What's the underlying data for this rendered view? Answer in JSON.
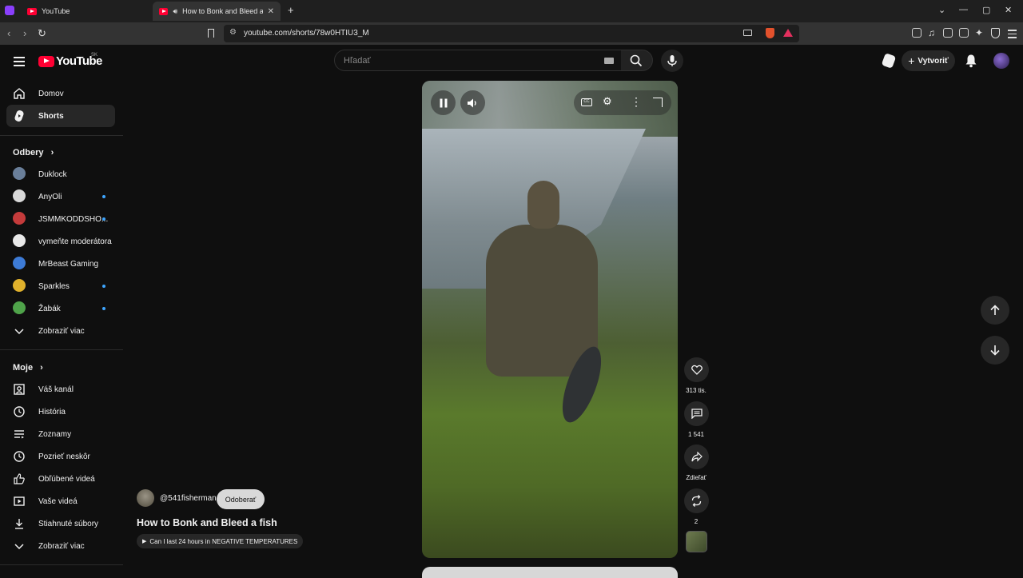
{
  "browser": {
    "tabs": [
      {
        "title": "YouTube",
        "active": false
      },
      {
        "title": "How to Bonk and Bleed a fish",
        "active": true
      }
    ],
    "url": "youtube.com/shorts/78w0HTIU3_M"
  },
  "masthead": {
    "logo_text": "YouTube",
    "country_code": "SK",
    "search_placeholder": "Hľadať",
    "create_label": "Vytvoriť"
  },
  "sidebar": {
    "main": [
      {
        "label": "Domov",
        "icon": "home-icon"
      },
      {
        "label": "Shorts",
        "icon": "shorts-icon",
        "active": true
      }
    ],
    "subscriptions_header": "Odbery",
    "subscriptions": [
      {
        "label": "Duklock",
        "live": false,
        "color": "#6a7f9a"
      },
      {
        "label": "AnyOli",
        "live": true,
        "color": "#d9d9d9"
      },
      {
        "label": "JSMMKODDSHO...",
        "live": true,
        "color": "#c43b3b"
      },
      {
        "label": "vymeňte moderátora",
        "live": false,
        "color": "#e8e8e8"
      },
      {
        "label": "MrBeast Gaming",
        "live": false,
        "color": "#3d7bd6"
      },
      {
        "label": "Sparkles",
        "live": true,
        "color": "#e0b12c"
      },
      {
        "label": "Žabák",
        "live": true,
        "color": "#4fa34a"
      }
    ],
    "subscriptions_more": "Zobraziť viac",
    "you_header": "Moje",
    "you_items": [
      {
        "label": "Váš kanál",
        "icon": "user-channel-icon"
      },
      {
        "label": "História",
        "icon": "history-icon"
      },
      {
        "label": "Zoznamy",
        "icon": "playlists-icon"
      },
      {
        "label": "Pozrieť neskôr",
        "icon": "watch-later-icon"
      },
      {
        "label": "Obľúbené videá",
        "icon": "thumbs-up-icon"
      },
      {
        "label": "Vaše videá",
        "icon": "your-videos-icon"
      },
      {
        "label": "Stiahnuté súbory",
        "icon": "download-icon"
      }
    ],
    "you_more": "Zobraziť viac"
  },
  "short": {
    "channel_handle": "@541fisherman",
    "subscribe_label": "Odoberať",
    "title": "How to Bonk and Bleed a fish",
    "related_label": "Can I last 24 hours in NEGATIVE TEMPERATURES"
  },
  "actions": {
    "likes": "313 tis.",
    "comments": "1 541",
    "share": "Zdieľať",
    "remix": "2"
  },
  "colors": {
    "background": "#0f0f0f",
    "brand_red": "#ff0033",
    "chip": "#272727",
    "live_dot": "#3ea6ff"
  }
}
